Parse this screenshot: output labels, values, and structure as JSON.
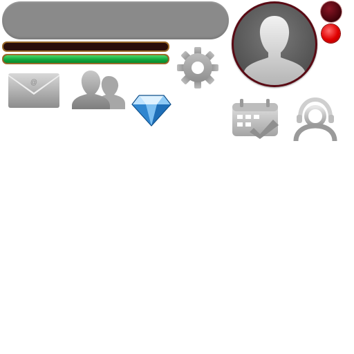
{
  "player": {
    "name": "",
    "xp_progress": 0,
    "energy_progress": 1.0
  },
  "icons": {
    "settings": "gear-icon",
    "mail": "envelope-icon",
    "friends": "friends-icon",
    "gems": "diamond-icon",
    "calendar": "calendar-check-icon",
    "support": "support-agent-icon",
    "avatar": "user-silhouette-icon"
  },
  "colors": {
    "panel_gray": "#8a8a8a",
    "energy_green": "#0fa33a",
    "bar_border": "#9a6a2a",
    "avatar_ring": "#5a0a14",
    "status_dark": "#3a0008",
    "status_red": "#e00000",
    "diamond_blue": "#4aa3e8"
  }
}
